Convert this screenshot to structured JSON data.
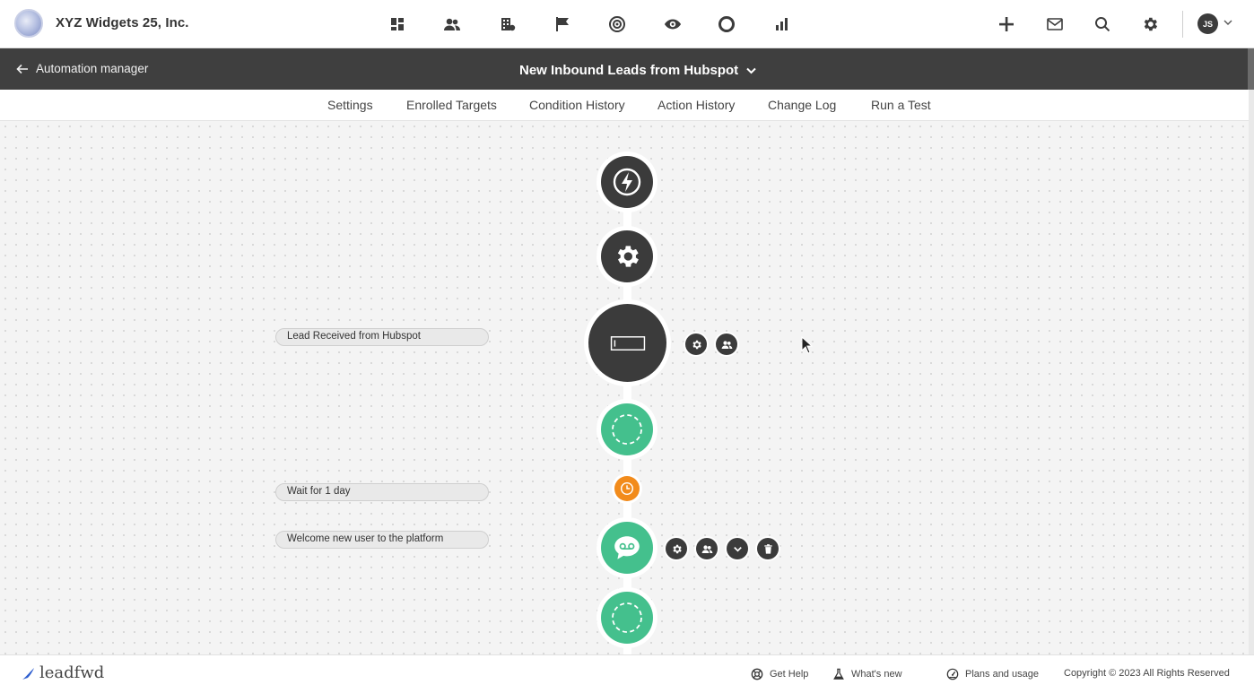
{
  "header": {
    "company_name": "XYZ Widgets 25, Inc.",
    "nav_icons": [
      "dashboard-icon",
      "contacts-icon",
      "companies-icon",
      "campaigns-flag-icon",
      "targets-icon",
      "visitors-eye-icon",
      "circle-icon",
      "reports-bar-chart-icon"
    ],
    "actions": [
      "add-icon",
      "mail-icon",
      "search-icon",
      "settings-gear-icon"
    ],
    "user_initials": "JS"
  },
  "subheader": {
    "back_label": "Automation manager",
    "automation_title": "New Inbound Leads from Hubspot"
  },
  "tabs": [
    {
      "label": "Settings"
    },
    {
      "label": "Enrolled Targets"
    },
    {
      "label": "Condition History"
    },
    {
      "label": "Action History"
    },
    {
      "label": "Change Log"
    },
    {
      "label": "Run a Test"
    }
  ],
  "flow": {
    "nodes": [
      {
        "type": "trigger",
        "icon": "lightning-icon"
      },
      {
        "type": "settings",
        "icon": "gear-icon"
      },
      {
        "type": "condition",
        "icon": "rectangle-icon",
        "label": "Lead Received from Hubspot"
      },
      {
        "type": "add-step",
        "icon": "dashed-circle-icon"
      },
      {
        "type": "wait",
        "icon": "clock-icon",
        "label": "Wait for 1 day"
      },
      {
        "type": "action",
        "icon": "voicemail-icon",
        "label": "Welcome new user to the platform"
      },
      {
        "type": "add-step",
        "icon": "dashed-circle-icon"
      }
    ]
  },
  "footer": {
    "brand": "leadfwd",
    "links": [
      {
        "label": "Get Help",
        "icon": "help-lifebuoy-icon"
      },
      {
        "label": "What's new",
        "icon": "flask-icon"
      },
      {
        "label": "Plans and usage",
        "icon": "gauge-icon"
      }
    ],
    "copyright": "Copyright © 2023 All Rights Reserved"
  },
  "colors": {
    "dark_node": "#3b3b3b",
    "green_node": "#44c08d",
    "orange_node": "#f28b1b",
    "header_dark": "#3f3f3f"
  }
}
